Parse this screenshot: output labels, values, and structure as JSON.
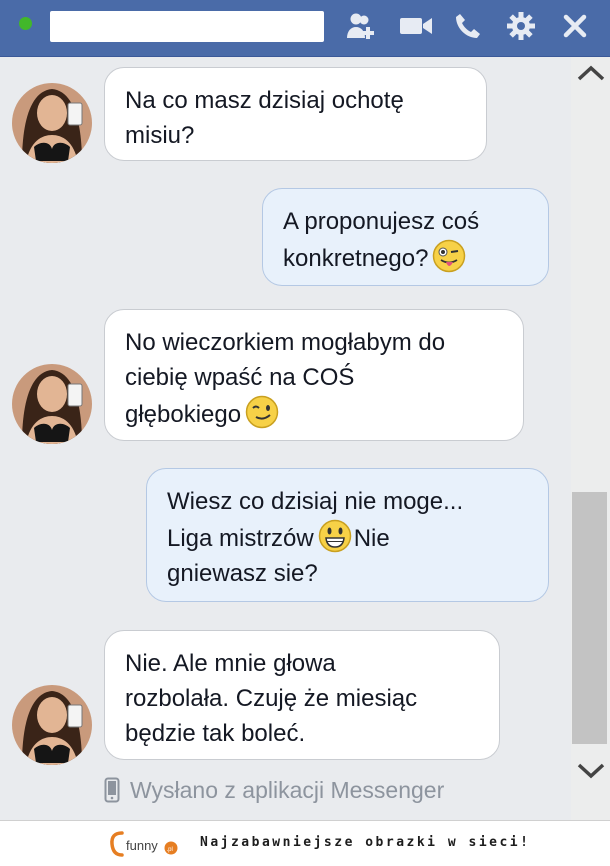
{
  "header": {
    "status_color": "#42b72a",
    "bar_color": "#4a6ba8",
    "contact_name": "",
    "icons": [
      "add-friend-icon",
      "video-call-icon",
      "phone-icon",
      "gear-icon",
      "close-icon"
    ]
  },
  "messages": [
    {
      "direction": "incoming",
      "lines": [
        "Na co masz dzisiaj ochotę",
        "misiu?"
      ]
    },
    {
      "direction": "outgoing",
      "lines": [
        "A proponujesz coś",
        "konkretnego?"
      ],
      "emoji": "tongue-wink-emoji"
    },
    {
      "direction": "incoming",
      "lines": [
        "No wieczorkiem mogłabym do",
        "ciebię wpaść na COŚ",
        "głębokiego"
      ],
      "emoji": "wink-emoji"
    },
    {
      "direction": "outgoing",
      "lines": [
        "Wiesz co dzisiaj nie moge...",
        "Liga mistrzów",
        "gniewasz sie?"
      ],
      "inline_emoji": "grin-emoji",
      "inline_after": "Nie"
    },
    {
      "direction": "incoming",
      "lines": [
        "Nie. Ale mnie głowa",
        "rozbolała. Czuję że miesiąc",
        "będzie tak boleć."
      ]
    }
  ],
  "sent_via": "Wysłano z aplikacji Messenger",
  "footer": {
    "logo_text": "funny",
    "logo_suffix": ".pl",
    "tagline": "Najzabawniejsze obrazki w sieci!"
  }
}
